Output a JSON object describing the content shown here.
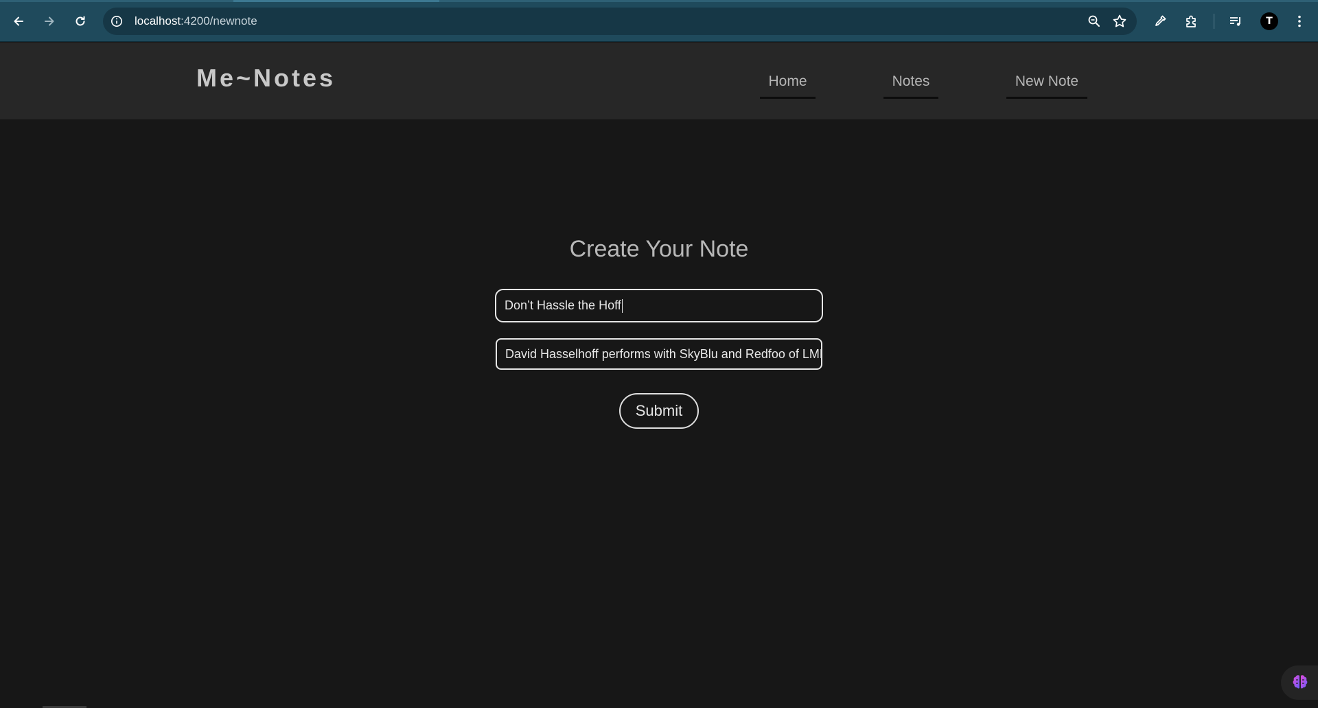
{
  "browser": {
    "url_host": "localhost",
    "url_path": ":4200/newnote",
    "back_icon": "arrow-left-icon",
    "forward_icon": "arrow-right-icon",
    "reload_icon": "reload-icon",
    "profile_initial": "T",
    "accent": "#1f4a5c"
  },
  "header": {
    "brand": "Me~Notes",
    "nav": [
      {
        "label": "Home"
      },
      {
        "label": "Notes"
      },
      {
        "label": "New Note"
      }
    ]
  },
  "form": {
    "title": "Create Your Note",
    "title_value": "Don’t Hassle the Hoff",
    "body_value": "David Hasselhoff performs with SkyBlu and Redfoo of LMFAO",
    "submit_label": "Submit"
  }
}
